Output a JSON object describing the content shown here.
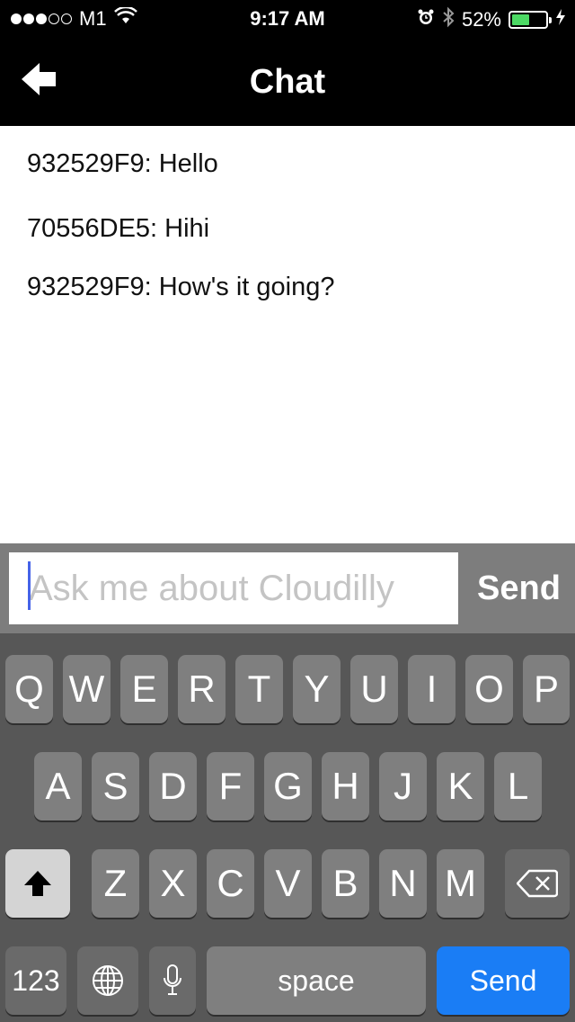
{
  "status_bar": {
    "carrier": "M1",
    "time": "9:17 AM",
    "battery_percent": "52%",
    "battery_level": 0.52,
    "signal_dots": [
      true,
      true,
      true,
      false,
      false
    ],
    "icons": [
      "wifi-icon",
      "alarm-icon",
      "bluetooth-icon",
      "charging-icon"
    ],
    "battery_color": "#4cd964"
  },
  "nav": {
    "title": "Chat",
    "back_icon": "arrow-left-icon"
  },
  "messages": [
    {
      "text": "932529F9: Hello"
    },
    {
      "text": "70556DE5: Hihi"
    },
    {
      "text": "932529F9: How's it going?"
    }
  ],
  "input": {
    "placeholder": "Ask me about Cloudilly",
    "value": "",
    "send_label": "Send"
  },
  "keyboard": {
    "row1": [
      "Q",
      "W",
      "E",
      "R",
      "T",
      "Y",
      "U",
      "I",
      "O",
      "P"
    ],
    "row2": [
      "A",
      "S",
      "D",
      "F",
      "G",
      "H",
      "J",
      "K",
      "L"
    ],
    "row3": [
      "Z",
      "X",
      "C",
      "V",
      "B",
      "N",
      "M"
    ],
    "numbers_label": "123",
    "space_label": "space",
    "return_label": "Send",
    "icons": [
      "shift-icon",
      "backspace-icon",
      "globe-icon",
      "microphone-icon"
    ],
    "return_color": "#1a7df5"
  }
}
